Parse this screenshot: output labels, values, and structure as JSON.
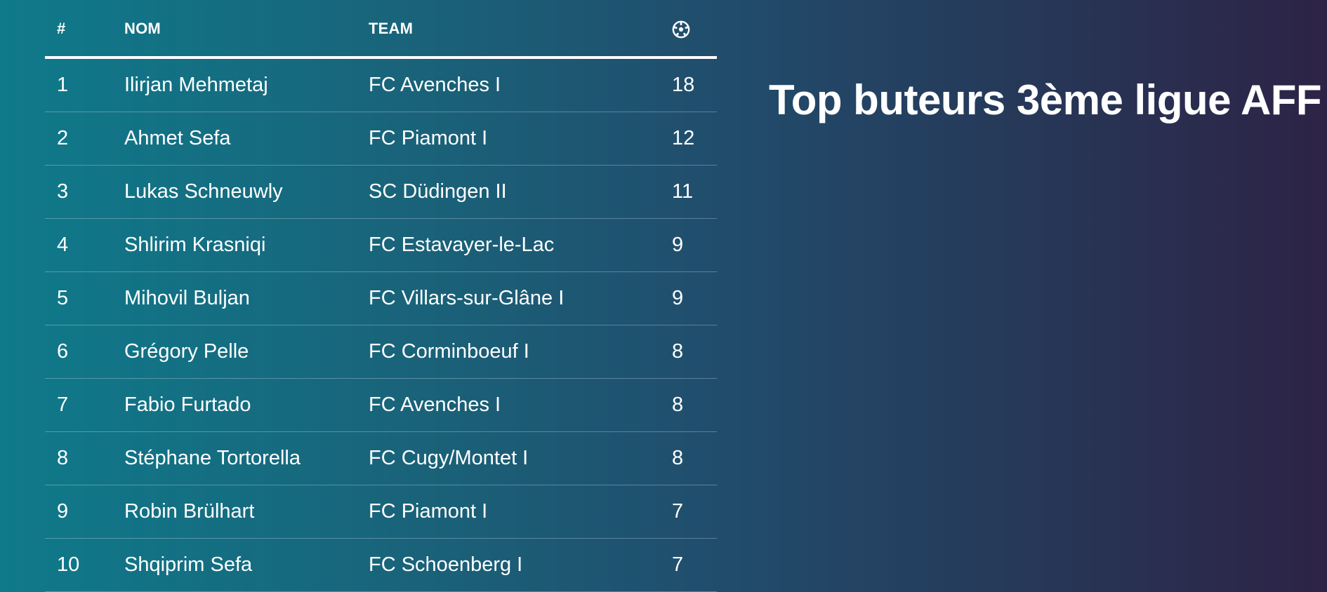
{
  "title": "Top buteurs 3ème ligue AFF",
  "table": {
    "headers": {
      "rank": "#",
      "name": "NOM",
      "team": "TEAM",
      "goals_icon": "soccer-ball-icon"
    },
    "rows": [
      {
        "rank": "1",
        "name": "Ilirjan Mehmetaj",
        "team": "FC Avenches I",
        "goals": "18"
      },
      {
        "rank": "2",
        "name": "Ahmet Sefa",
        "team": "FC Piamont I",
        "goals": "12"
      },
      {
        "rank": "3",
        "name": "Lukas Schneuwly",
        "team": "SC Düdingen II",
        "goals": "11"
      },
      {
        "rank": "4",
        "name": "Shlirim Krasniqi",
        "team": "FC Estavayer-le-Lac",
        "goals": "9"
      },
      {
        "rank": "5",
        "name": "Mihovil Buljan",
        "team": "FC Villars-sur-Glâne I",
        "goals": "9"
      },
      {
        "rank": "6",
        "name": "Grégory Pelle",
        "team": "FC Corminboeuf I",
        "goals": "8"
      },
      {
        "rank": "7",
        "name": "Fabio Furtado",
        "team": "FC Avenches I",
        "goals": "8"
      },
      {
        "rank": "8",
        "name": "Stéphane Tortorella",
        "team": "FC Cugy/Montet I",
        "goals": "8"
      },
      {
        "rank": "9",
        "name": "Robin Brülhart",
        "team": "FC Piamont I",
        "goals": "7"
      },
      {
        "rank": "10",
        "name": "Shqiprim Sefa",
        "team": "FC Schoenberg I",
        "goals": "7"
      }
    ]
  },
  "colors": {
    "gradient_start": "#0f7a8b",
    "gradient_end": "#2d2346",
    "text": "#ffffff"
  }
}
